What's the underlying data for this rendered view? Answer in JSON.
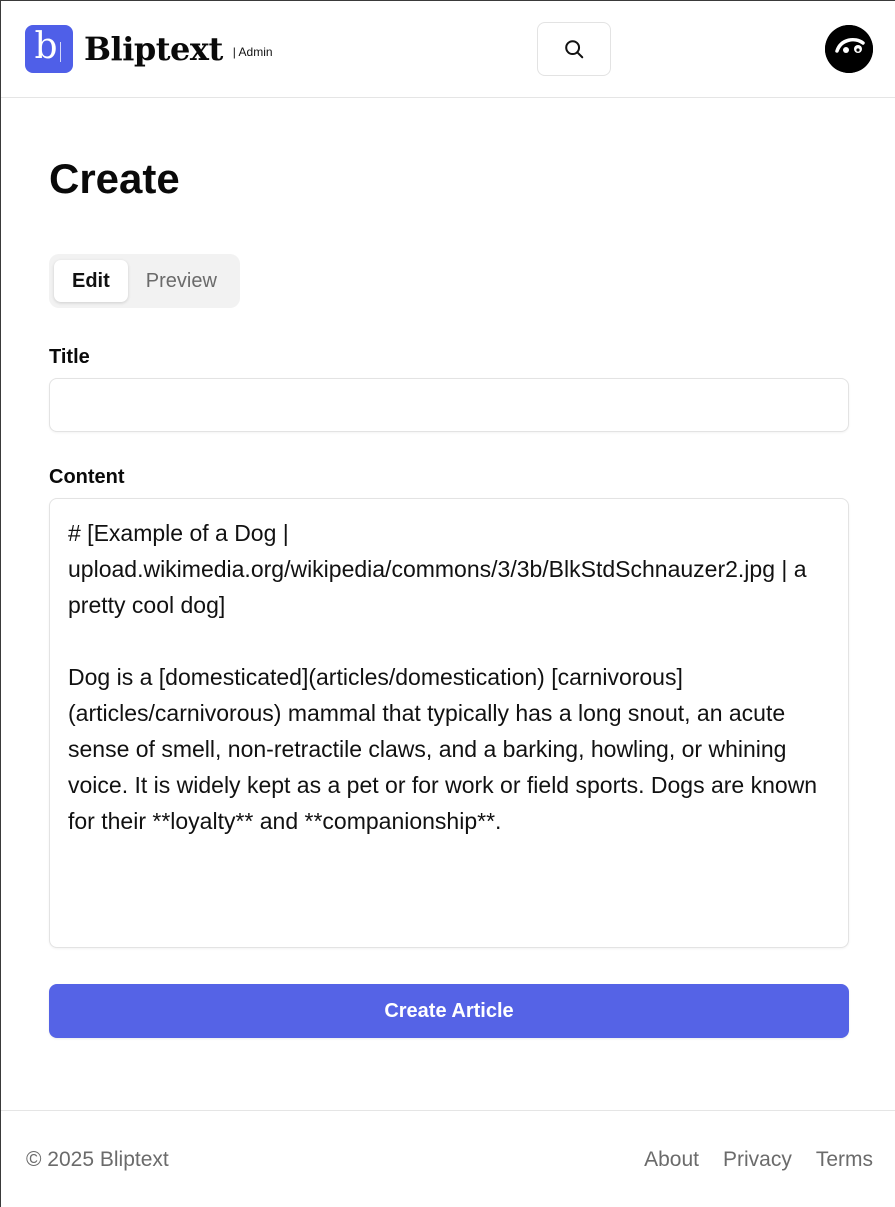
{
  "header": {
    "brand_letter": "b",
    "brand_name": "Bliptext",
    "brand_sub": "| Admin",
    "search_icon": "search-icon",
    "avatar_icon": "avatar"
  },
  "main": {
    "page_title": "Create",
    "tabs": [
      {
        "label": "Edit",
        "active": true
      },
      {
        "label": "Preview",
        "active": false
      }
    ],
    "title_label": "Title",
    "title_value": "",
    "content_label": "Content",
    "content_value": "# [Example of a Dog | upload.wikimedia.org/wikipedia/commons/3/3b/BlkStdSchnauzer2.jpg | a pretty cool dog]\n\nDog is a [domesticated](articles/domestication) [carnivorous](articles/carnivorous) mammal that typically has a long snout, an acute sense of smell, non-retractile claws, and a barking, howling, or whining voice. It is widely kept as a pet or for work or field sports. Dogs are known for their **loyalty** and **companionship**.",
    "submit_label": "Create Article"
  },
  "footer": {
    "copyright": "© 2025 Bliptext",
    "links": [
      "About",
      "Privacy",
      "Terms"
    ]
  },
  "colors": {
    "accent": "#5563e6",
    "logo_bg": "#4f5fe8"
  }
}
